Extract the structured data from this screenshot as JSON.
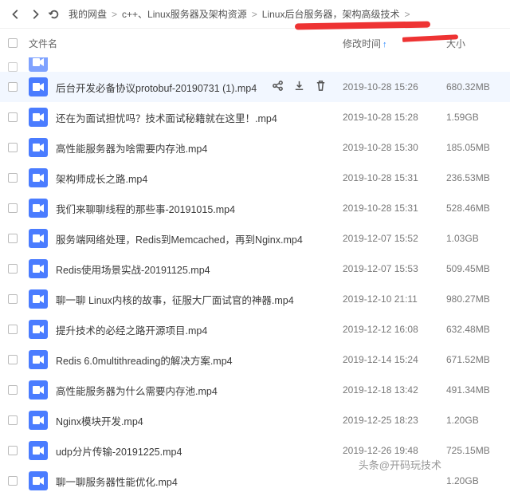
{
  "nav": {
    "back": "back",
    "fwd": "forward",
    "refresh": "refresh"
  },
  "breadcrumb": [
    "我的网盘",
    "c++、Linux服务器及架构资源",
    "Linux后台服务器，架构高级技术"
  ],
  "columns": {
    "name": "文件名",
    "date": "修改时间",
    "size": "大小",
    "sort_icon": "↑"
  },
  "cutoff": {
    "date": "",
    "size": ""
  },
  "hover_index": 1,
  "files": [
    {
      "name": "后台开发必备协议protobuf-20190731 (1).mp4",
      "date": "2019-10-28 15:26",
      "size": "680.32MB",
      "hover": true
    },
    {
      "name": "还在为面试担忧吗？技术面试秘籍就在这里！.mp4",
      "date": "2019-10-28 15:28",
      "size": "1.59GB"
    },
    {
      "name": "高性能服务器为啥需要内存池.mp4",
      "date": "2019-10-28 15:30",
      "size": "185.05MB"
    },
    {
      "name": "架构师成长之路.mp4",
      "date": "2019-10-28 15:31",
      "size": "236.53MB"
    },
    {
      "name": "我们来聊聊线程的那些事-20191015.mp4",
      "date": "2019-10-28 15:31",
      "size": "528.46MB"
    },
    {
      "name": "服务端网络处理，Redis到Memcached，再到Nginx.mp4",
      "date": "2019-12-07 15:52",
      "size": "1.03GB"
    },
    {
      "name": "Redis使用场景实战-20191125.mp4",
      "date": "2019-12-07 15:53",
      "size": "509.45MB"
    },
    {
      "name": "聊一聊 Linux内核的故事，征服大厂面试官的神器.mp4",
      "date": "2019-12-10 21:11",
      "size": "980.27MB"
    },
    {
      "name": "提升技术的必经之路开源项目.mp4",
      "date": "2019-12-12 16:08",
      "size": "632.48MB"
    },
    {
      "name": "Redis 6.0multithreading的解决方案.mp4",
      "date": "2019-12-14 15:24",
      "size": "671.52MB"
    },
    {
      "name": "高性能服务器为什么需要内存池.mp4",
      "date": "2019-12-18 13:42",
      "size": "491.34MB"
    },
    {
      "name": "Nginx模块开发.mp4",
      "date": "2019-12-25 18:23",
      "size": "1.20GB"
    },
    {
      "name": "udp分片传输-20191225.mp4",
      "date": "2019-12-26 19:48",
      "size": "725.15MB"
    },
    {
      "name": "聊一聊服务器性能优化.mp4",
      "date": "",
      "size": "1.20GB"
    }
  ],
  "watermark": "头条@开码玩技术"
}
